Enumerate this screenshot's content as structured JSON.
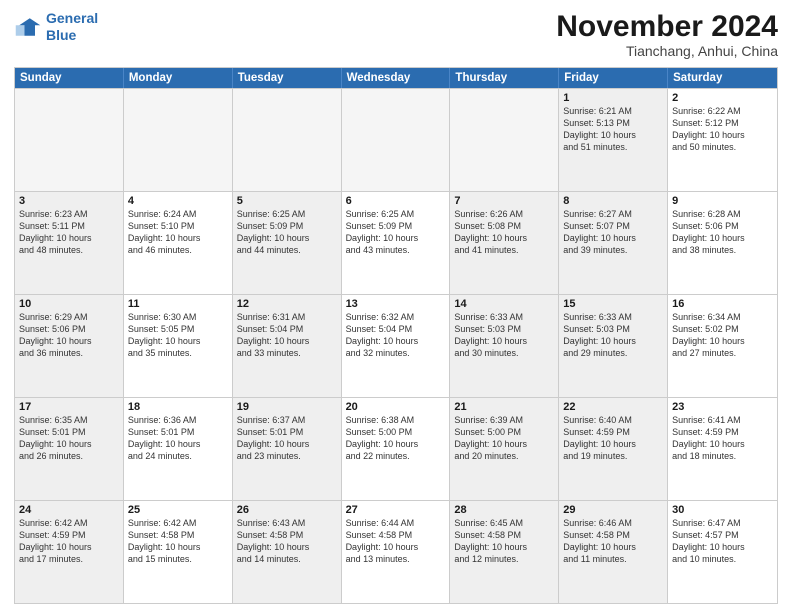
{
  "logo": {
    "line1": "General",
    "line2": "Blue"
  },
  "title": "November 2024",
  "location": "Tianchang, Anhui, China",
  "weekdays": [
    "Sunday",
    "Monday",
    "Tuesday",
    "Wednesday",
    "Thursday",
    "Friday",
    "Saturday"
  ],
  "weeks": [
    [
      {
        "day": "",
        "info": "",
        "empty": true
      },
      {
        "day": "",
        "info": "",
        "empty": true
      },
      {
        "day": "",
        "info": "",
        "empty": true
      },
      {
        "day": "",
        "info": "",
        "empty": true
      },
      {
        "day": "",
        "info": "",
        "empty": true
      },
      {
        "day": "1",
        "info": "Sunrise: 6:21 AM\nSunset: 5:13 PM\nDaylight: 10 hours\nand 51 minutes.",
        "shaded": true
      },
      {
        "day": "2",
        "info": "Sunrise: 6:22 AM\nSunset: 5:12 PM\nDaylight: 10 hours\nand 50 minutes.",
        "shaded": false
      }
    ],
    [
      {
        "day": "3",
        "info": "Sunrise: 6:23 AM\nSunset: 5:11 PM\nDaylight: 10 hours\nand 48 minutes.",
        "shaded": true
      },
      {
        "day": "4",
        "info": "Sunrise: 6:24 AM\nSunset: 5:10 PM\nDaylight: 10 hours\nand 46 minutes.",
        "shaded": false
      },
      {
        "day": "5",
        "info": "Sunrise: 6:25 AM\nSunset: 5:09 PM\nDaylight: 10 hours\nand 44 minutes.",
        "shaded": true
      },
      {
        "day": "6",
        "info": "Sunrise: 6:25 AM\nSunset: 5:09 PM\nDaylight: 10 hours\nand 43 minutes.",
        "shaded": false
      },
      {
        "day": "7",
        "info": "Sunrise: 6:26 AM\nSunset: 5:08 PM\nDaylight: 10 hours\nand 41 minutes.",
        "shaded": true
      },
      {
        "day": "8",
        "info": "Sunrise: 6:27 AM\nSunset: 5:07 PM\nDaylight: 10 hours\nand 39 minutes.",
        "shaded": true
      },
      {
        "day": "9",
        "info": "Sunrise: 6:28 AM\nSunset: 5:06 PM\nDaylight: 10 hours\nand 38 minutes.",
        "shaded": false
      }
    ],
    [
      {
        "day": "10",
        "info": "Sunrise: 6:29 AM\nSunset: 5:06 PM\nDaylight: 10 hours\nand 36 minutes.",
        "shaded": true
      },
      {
        "day": "11",
        "info": "Sunrise: 6:30 AM\nSunset: 5:05 PM\nDaylight: 10 hours\nand 35 minutes.",
        "shaded": false
      },
      {
        "day": "12",
        "info": "Sunrise: 6:31 AM\nSunset: 5:04 PM\nDaylight: 10 hours\nand 33 minutes.",
        "shaded": true
      },
      {
        "day": "13",
        "info": "Sunrise: 6:32 AM\nSunset: 5:04 PM\nDaylight: 10 hours\nand 32 minutes.",
        "shaded": false
      },
      {
        "day": "14",
        "info": "Sunrise: 6:33 AM\nSunset: 5:03 PM\nDaylight: 10 hours\nand 30 minutes.",
        "shaded": true
      },
      {
        "day": "15",
        "info": "Sunrise: 6:33 AM\nSunset: 5:03 PM\nDaylight: 10 hours\nand 29 minutes.",
        "shaded": true
      },
      {
        "day": "16",
        "info": "Sunrise: 6:34 AM\nSunset: 5:02 PM\nDaylight: 10 hours\nand 27 minutes.",
        "shaded": false
      }
    ],
    [
      {
        "day": "17",
        "info": "Sunrise: 6:35 AM\nSunset: 5:01 PM\nDaylight: 10 hours\nand 26 minutes.",
        "shaded": true
      },
      {
        "day": "18",
        "info": "Sunrise: 6:36 AM\nSunset: 5:01 PM\nDaylight: 10 hours\nand 24 minutes.",
        "shaded": false
      },
      {
        "day": "19",
        "info": "Sunrise: 6:37 AM\nSunset: 5:01 PM\nDaylight: 10 hours\nand 23 minutes.",
        "shaded": true
      },
      {
        "day": "20",
        "info": "Sunrise: 6:38 AM\nSunset: 5:00 PM\nDaylight: 10 hours\nand 22 minutes.",
        "shaded": false
      },
      {
        "day": "21",
        "info": "Sunrise: 6:39 AM\nSunset: 5:00 PM\nDaylight: 10 hours\nand 20 minutes.",
        "shaded": true
      },
      {
        "day": "22",
        "info": "Sunrise: 6:40 AM\nSunset: 4:59 PM\nDaylight: 10 hours\nand 19 minutes.",
        "shaded": true
      },
      {
        "day": "23",
        "info": "Sunrise: 6:41 AM\nSunset: 4:59 PM\nDaylight: 10 hours\nand 18 minutes.",
        "shaded": false
      }
    ],
    [
      {
        "day": "24",
        "info": "Sunrise: 6:42 AM\nSunset: 4:59 PM\nDaylight: 10 hours\nand 17 minutes.",
        "shaded": true
      },
      {
        "day": "25",
        "info": "Sunrise: 6:42 AM\nSunset: 4:58 PM\nDaylight: 10 hours\nand 15 minutes.",
        "shaded": false
      },
      {
        "day": "26",
        "info": "Sunrise: 6:43 AM\nSunset: 4:58 PM\nDaylight: 10 hours\nand 14 minutes.",
        "shaded": true
      },
      {
        "day": "27",
        "info": "Sunrise: 6:44 AM\nSunset: 4:58 PM\nDaylight: 10 hours\nand 13 minutes.",
        "shaded": false
      },
      {
        "day": "28",
        "info": "Sunrise: 6:45 AM\nSunset: 4:58 PM\nDaylight: 10 hours\nand 12 minutes.",
        "shaded": true
      },
      {
        "day": "29",
        "info": "Sunrise: 6:46 AM\nSunset: 4:58 PM\nDaylight: 10 hours\nand 11 minutes.",
        "shaded": true
      },
      {
        "day": "30",
        "info": "Sunrise: 6:47 AM\nSunset: 4:57 PM\nDaylight: 10 hours\nand 10 minutes.",
        "shaded": false
      }
    ]
  ]
}
